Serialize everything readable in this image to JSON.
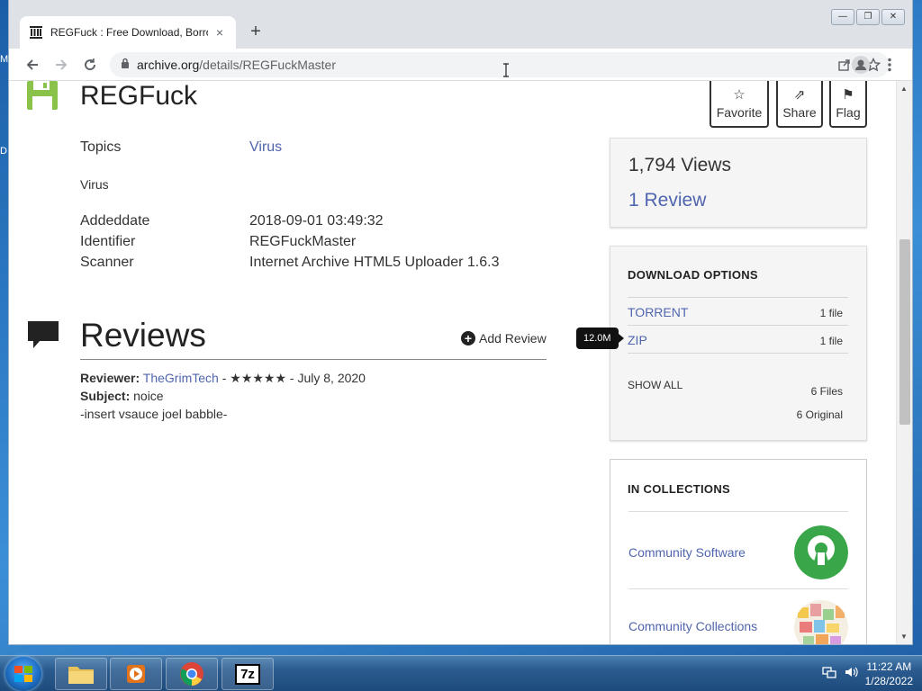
{
  "colors": {
    "link": "#4f65ad",
    "accent_green": "#8bc34a",
    "tab_strip": "#dee1e6"
  },
  "browser": {
    "tab_title": "REGFuck : Free Download, Borrow",
    "tab_close": "×",
    "new_tab": "+",
    "url_host": "archive.org",
    "url_path": "/details/REGFuckMaster",
    "window_controls": [
      "—",
      "❐",
      "✕"
    ],
    "icons": [
      "archive-favicon",
      "back-icon",
      "forward-icon",
      "reload-icon",
      "lock-icon",
      "share-icon",
      "bookmark-star-icon",
      "profile-icon",
      "kebab-menu-icon"
    ]
  },
  "desktop": {
    "stub_labels": [
      "M",
      "D"
    ]
  },
  "item": {
    "title": "REGFuck",
    "actions": [
      {
        "label": "Favorite",
        "icon": "☆"
      },
      {
        "label": "Share",
        "icon": "⇗"
      },
      {
        "label": "Flag",
        "icon": "⚑"
      }
    ],
    "topics_label": "Topics",
    "topics_value": "Virus",
    "description": "Virus",
    "metadata": [
      {
        "label": "Addeddate",
        "value": "2018-09-01 03:49:32"
      },
      {
        "label": "Identifier",
        "value": "REGFuckMaster"
      },
      {
        "label": "Scanner",
        "value": "Internet Archive HTML5 Uploader 1.6.3"
      }
    ]
  },
  "reviews": {
    "heading": "Reviews",
    "add_label": "Add Review",
    "add_icon": "+",
    "reviewer_label": "Reviewer:",
    "reviewer_name": "TheGrimTech",
    "rating_and_date": " - ★★★★★ - July 8, 2020",
    "subject_label": "Subject:",
    "subject": "noice",
    "body": "-insert vsauce joel babble-"
  },
  "stats": {
    "views": "1,794 Views",
    "reviews": "1 Review"
  },
  "downloads": {
    "heading": "DOWNLOAD OPTIONS",
    "options": [
      {
        "name": "TORRENT",
        "count": "1 file"
      },
      {
        "name": "ZIP",
        "count": "1 file"
      }
    ],
    "tooltip": "12.0M",
    "show_all": "SHOW ALL",
    "files": "6 Files",
    "original": "6 Original"
  },
  "collections": {
    "heading": "IN COLLECTIONS",
    "items": [
      {
        "name": "Community Software"
      },
      {
        "name": "Community Collections"
      }
    ]
  },
  "taskbar": {
    "time": "11:22 AM",
    "date": "1/28/2022",
    "apps": [
      "explorer",
      "media-player",
      "chrome",
      "7zip"
    ],
    "sevenzip_label": "7z"
  }
}
